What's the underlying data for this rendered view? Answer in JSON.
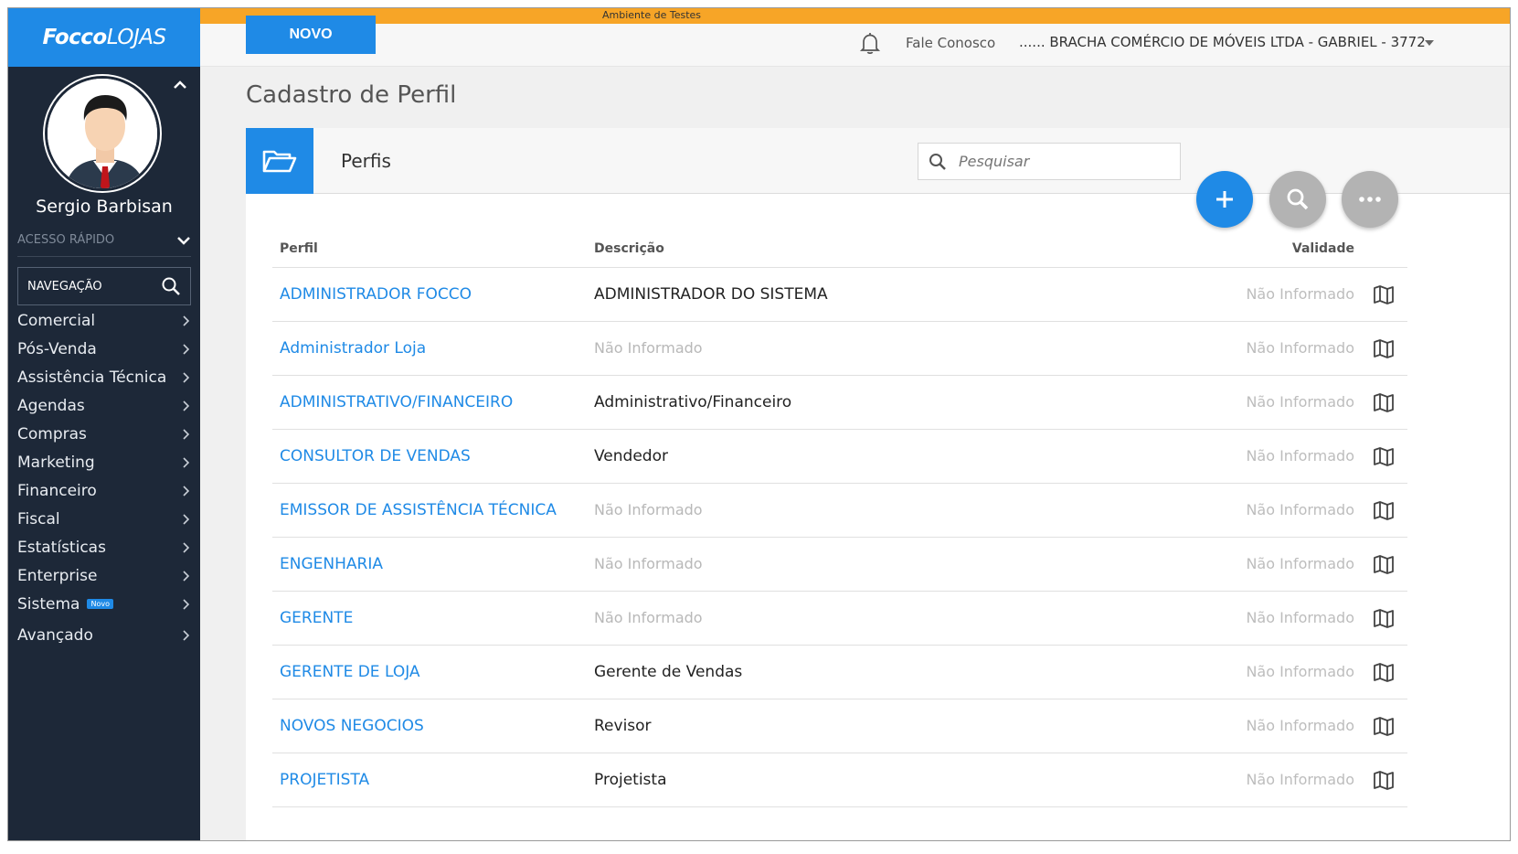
{
  "brand": {
    "logo_bold": "Focco",
    "logo_light": "LOJAS"
  },
  "user": {
    "name": "Sergio Barbisan"
  },
  "sidebar": {
    "quick_access_label": "ACESSO RÁPIDO",
    "nav_search_label": "NAVEGAÇÃO",
    "items": [
      {
        "label": "Comercial"
      },
      {
        "label": "Pós-Venda"
      },
      {
        "label": "Assistência Técnica"
      },
      {
        "label": "Agendas"
      },
      {
        "label": "Compras"
      },
      {
        "label": "Marketing"
      },
      {
        "label": "Financeiro"
      },
      {
        "label": "Fiscal"
      },
      {
        "label": "Estatísticas"
      },
      {
        "label": "Enterprise"
      },
      {
        "label": "Sistema",
        "badge": "Novo"
      },
      {
        "label": "Avançado"
      }
    ]
  },
  "env_banner": "Ambiente de Testes",
  "topbar": {
    "new_button": "NOVO",
    "contact": "Fale Conosco",
    "company": "...... BRACHA COMÉRCIO DE MÓVEIS LTDA - GABRIEL - 3772"
  },
  "page": {
    "title": "Cadastro de Perfil"
  },
  "card": {
    "title": "Perfis",
    "search_placeholder": "Pesquisar"
  },
  "table": {
    "headers": {
      "perfil": "Perfil",
      "descricao": "Descrição",
      "validade": "Validade"
    },
    "rows": [
      {
        "perfil": "ADMINISTRADOR FOCCO",
        "descricao": "ADMINISTRADOR DO SISTEMA",
        "validade": "Não Informado"
      },
      {
        "perfil": "Administrador Loja",
        "descricao": "Não Informado",
        "validade": "Não Informado",
        "empty": true
      },
      {
        "perfil": "ADMINISTRATIVO/FINANCEIRO",
        "descricao": "Administrativo/Financeiro",
        "validade": "Não Informado"
      },
      {
        "perfil": "CONSULTOR DE VENDAS",
        "descricao": "Vendedor",
        "validade": "Não Informado"
      },
      {
        "perfil": "EMISSOR DE ASSISTÊNCIA TÉCNICA",
        "descricao": "Não Informado",
        "validade": "Não Informado",
        "empty": true
      },
      {
        "perfil": "ENGENHARIA",
        "descricao": "Não Informado",
        "validade": "Não Informado",
        "empty": true
      },
      {
        "perfil": "GERENTE",
        "descricao": "Não Informado",
        "validade": "Não Informado",
        "empty": true
      },
      {
        "perfil": "GERENTE DE LOJA",
        "descricao": "Gerente de Vendas",
        "validade": "Não Informado"
      },
      {
        "perfil": "NOVOS NEGOCIOS",
        "descricao": "Revisor",
        "validade": "Não Informado"
      },
      {
        "perfil": "PROJETISTA",
        "descricao": "Projetista",
        "validade": "Não Informado"
      }
    ]
  },
  "colors": {
    "primary": "#1f8ae6",
    "sidebar": "#1d2838",
    "env": "#f7a527",
    "fab_gray": "#b3b3b3"
  }
}
